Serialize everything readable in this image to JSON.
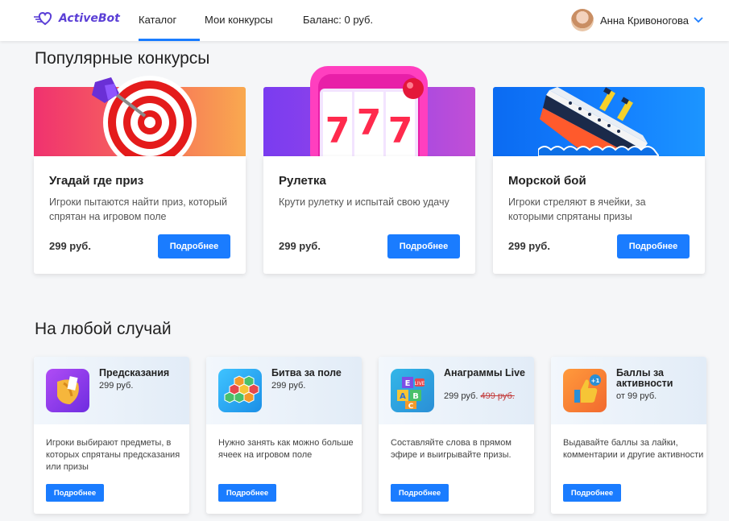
{
  "header": {
    "logo_text": "ActiveBot",
    "nav": [
      {
        "label": "Каталог",
        "active": true
      },
      {
        "label": "Мои конкурсы",
        "active": false
      },
      {
        "label": "Баланс: 0 руб.",
        "active": false
      }
    ],
    "user_name": "Анна Кривоногова"
  },
  "colors": {
    "accent": "#1a7cff",
    "logo": "#5b3fd6"
  },
  "popular": {
    "title": "Популярные конкурсы",
    "cards": [
      {
        "title": "Угадай где приз",
        "description": "Игроки пытаются найти приз, который спрятан на игровом поле",
        "price": "299 руб.",
        "button": "Подробнее",
        "image": "target-dart-icon"
      },
      {
        "title": "Рулетка",
        "description": "Крути рулетку и испытай свою удачу",
        "price": "299 руб.",
        "button": "Подробнее",
        "image": "slot-machine-777-icon"
      },
      {
        "title": "Морской бой",
        "description": "Игроки стреляют в ячейки, за которыми спрятаны призы",
        "price": "299 руб.",
        "button": "Подробнее",
        "image": "sinking-ship-icon"
      }
    ]
  },
  "any_occasion": {
    "title": "На любой случай",
    "cards": [
      {
        "title": "Предсказания",
        "price": "299 руб.",
        "old_price": "",
        "description": "Игроки выбирают предметы, в которых спрятаны предсказания или призы",
        "button": "Подробнее",
        "icon": "fortune-cookie-icon"
      },
      {
        "title": "Битва за поле",
        "price": "299 руб.",
        "old_price": "",
        "description": "Нужно занять как можно больше ячеек на игровом поле",
        "button": "Подробнее",
        "icon": "hex-grid-icon"
      },
      {
        "title": "Анаграммы Live",
        "price": "299 руб.",
        "old_price": "499 руб.",
        "description": "Составляйте слова в прямом эфире и выигрывайте призы.",
        "button": "Подробнее",
        "icon": "letter-blocks-icon"
      },
      {
        "title": "Баллы за активности",
        "price": "от 99 руб.",
        "old_price": "",
        "description": "Выдавайте баллы за лайки, комментарии и другие активности",
        "button": "Подробнее",
        "icon": "thumbs-up-icon"
      }
    ]
  }
}
